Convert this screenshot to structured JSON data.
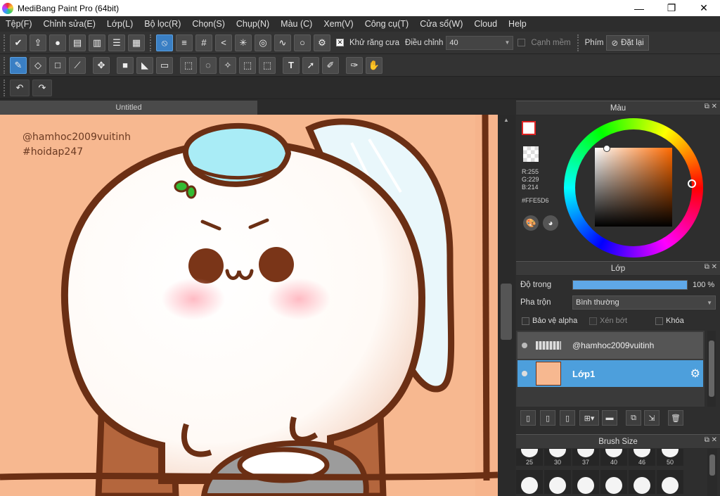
{
  "window": {
    "title": "MediBang Paint Pro (64bit)",
    "min": "—",
    "max": "❐",
    "close": "✕"
  },
  "menu": [
    "Tệp(F)",
    "Chỉnh sửa(E)",
    "Lớp(L)",
    "Bộ lọc(R)",
    "Chọn(S)",
    "Chụp(N)",
    "Màu (C)",
    "Xem(V)",
    "Công cụ(T)",
    "Cửa sổ(W)",
    "Cloud",
    "Help"
  ],
  "toolbar1": {
    "antialias_label": "Khử răng cưa",
    "adjust_label": "Điều chỉnh",
    "adjust_value": "40",
    "soft_edge_label": "Cạnh mềm",
    "key_label": "Phím",
    "reset_label": "Đặt lại"
  },
  "canvas": {
    "tab_title": "Untitled",
    "watermark_line1": "@hamhoc2009vuitinh",
    "watermark_line2": "#hoidap247",
    "background_color": "#F7B890"
  },
  "color_panel": {
    "title": "Màu",
    "r": "R:255",
    "g": "G:229",
    "b": "B:214",
    "hex": "#FFE5D6",
    "primary_color": "#FFFFFF",
    "secondary_color": "#FFE5D6"
  },
  "layer_panel": {
    "title": "Lớp",
    "opacity_label": "Độ trong",
    "opacity_value": "100 %",
    "opacity_level": 1.0,
    "blend_label": "Pha trộn",
    "blend_value": "Bình thường",
    "alpha_protect_label": "Bảo vệ alpha",
    "clipping_label": "Xén bớt",
    "lock_label": "Khóa",
    "layers": [
      {
        "name": "@hamhoc2009vuitinh",
        "selected": false
      },
      {
        "name": "Lớp1",
        "selected": true
      }
    ]
  },
  "brush_panel": {
    "title": "Brush Size",
    "sizes_row1": [
      "25",
      "30",
      "37",
      "40",
      "46",
      "50"
    ]
  }
}
